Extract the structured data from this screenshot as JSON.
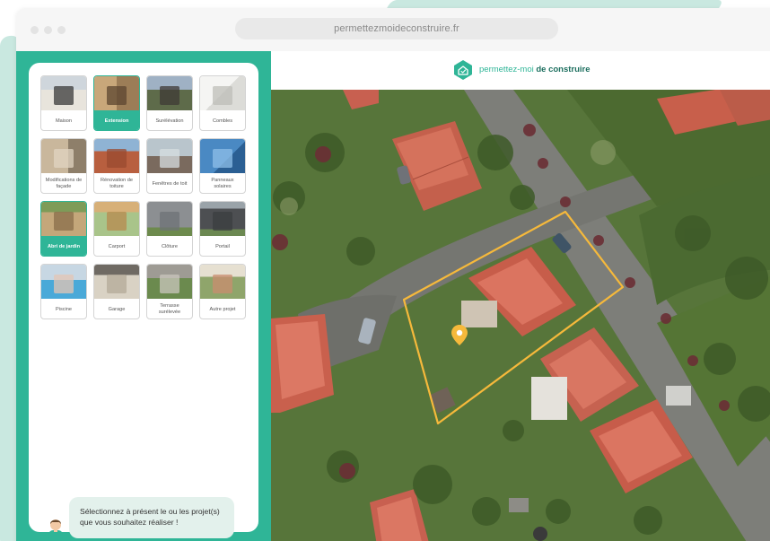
{
  "browser": {
    "url": "permettezmoideconstruire.fr"
  },
  "brand": {
    "part1": "permettez-moi",
    "part2": " de construire",
    "accent_color": "#2fb597",
    "highlight_color": "#f6b93b"
  },
  "projects": [
    {
      "label": "Maison",
      "thumb": "house-photo",
      "selected": false
    },
    {
      "label": "Extension",
      "thumb": "extension-photo",
      "selected": true
    },
    {
      "label": "Surélévation",
      "thumb": "raised-floor-photo",
      "selected": false
    },
    {
      "label": "Combles",
      "thumb": "attic-photo",
      "selected": false
    },
    {
      "label": "Modifications de façade",
      "thumb": "facade-photo",
      "selected": false
    },
    {
      "label": "Rénovation de toiture",
      "thumb": "roof-photo",
      "selected": false
    },
    {
      "label": "Fenêtres de toit",
      "thumb": "skylight-photo",
      "selected": false
    },
    {
      "label": "Panneaux solaires",
      "thumb": "solar-panel-photo",
      "selected": false
    },
    {
      "label": "Abri de jardin",
      "thumb": "garden-shed-photo",
      "selected": true
    },
    {
      "label": "Carport",
      "thumb": "carport-photo",
      "selected": false
    },
    {
      "label": "Clôture",
      "thumb": "fence-photo",
      "selected": false
    },
    {
      "label": "Portail",
      "thumb": "gate-photo",
      "selected": false
    },
    {
      "label": "Piscine",
      "thumb": "pool-photo",
      "selected": false
    },
    {
      "label": "Garage",
      "thumb": "garage-photo",
      "selected": false
    },
    {
      "label": "Terrasse surélevée",
      "thumb": "terrace-photo",
      "selected": false
    },
    {
      "label": "Autre projet",
      "thumb": "other-project-photo",
      "selected": false
    }
  ],
  "chat": {
    "message": "Sélectionnez à présent le ou les projet(s) que vous souhaitez réaliser !",
    "input_value": "",
    "send_icon": "arrow-up-icon"
  },
  "map": {
    "marker_icon": "location-pin-icon",
    "parcel_color": "#f6b93b"
  }
}
